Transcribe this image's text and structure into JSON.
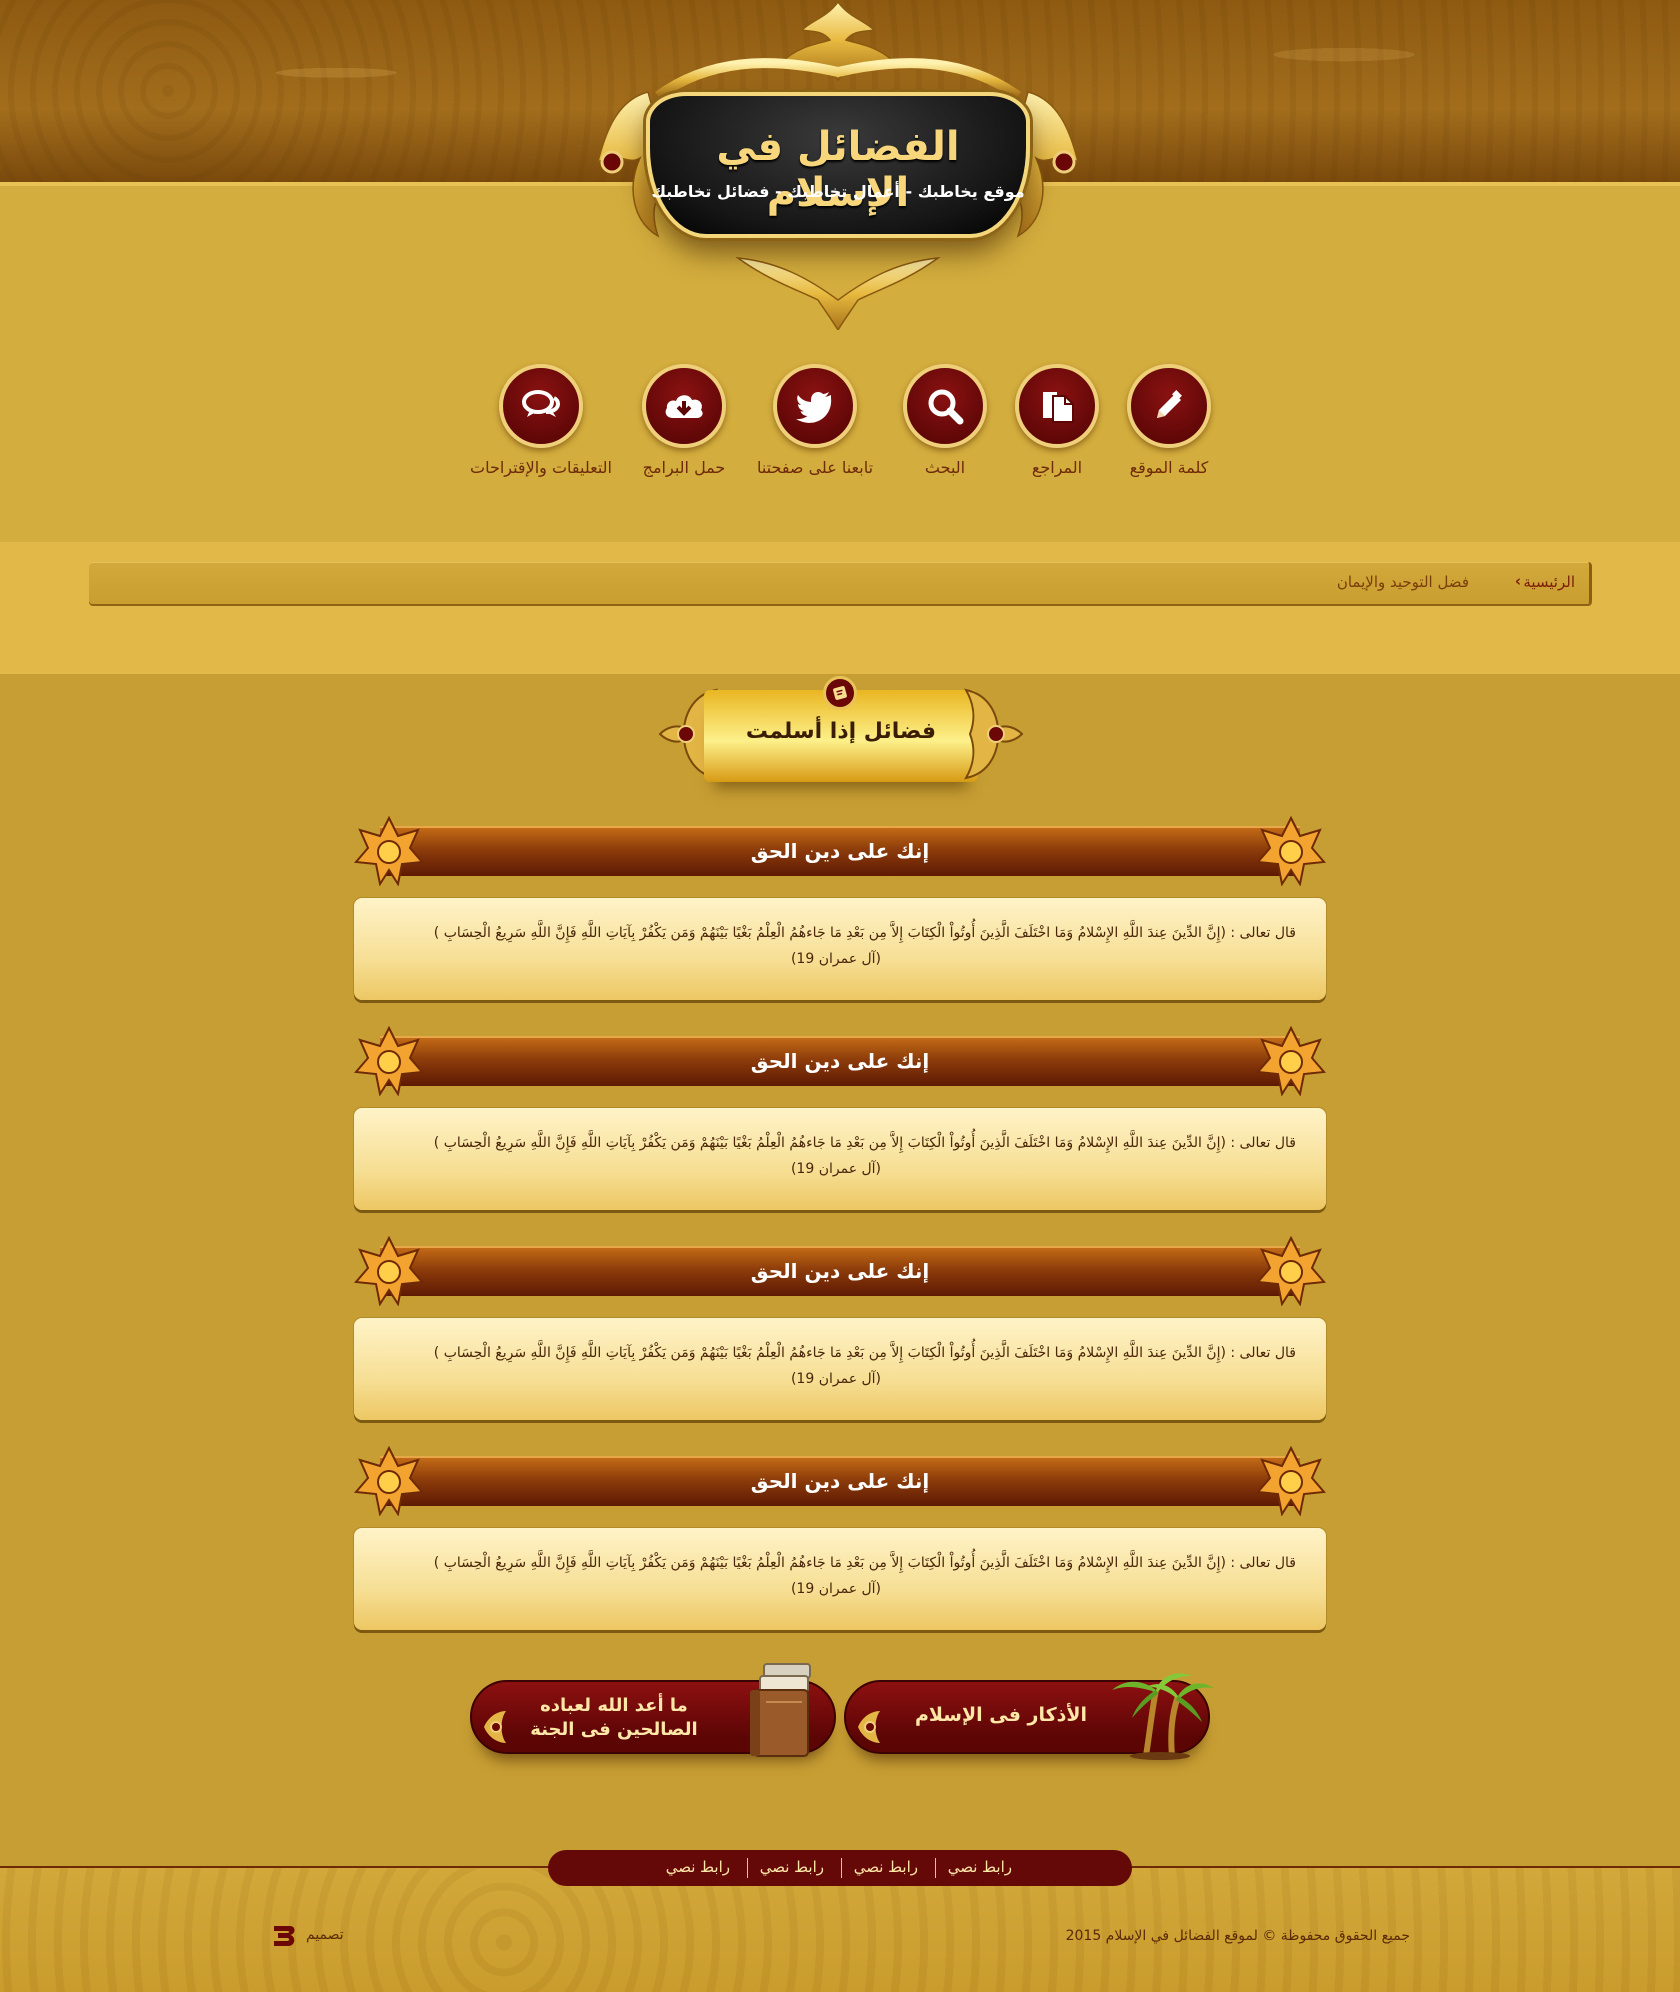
{
  "site": {
    "title": "الفضائل في الإسلام",
    "tagline": "موقع يخاطبك - أعمال تخاطبك - فضائل تخاطبك"
  },
  "nav": [
    {
      "label": "كلمة الموقع",
      "icon": "pencil-icon"
    },
    {
      "label": "المراجع",
      "icon": "documents-icon"
    },
    {
      "label": "البحث",
      "icon": "search-icon"
    },
    {
      "label": "تابعنا على صفحتنا",
      "icon": "twitter-icon"
    },
    {
      "label": "حمل البرامج",
      "icon": "cloud-download-icon"
    },
    {
      "label": "التعليقات والإقتراحات",
      "icon": "comments-icon"
    }
  ],
  "breadcrumb": {
    "home": "الرئيسية",
    "current": "فضل التوحيد والإيمان"
  },
  "section": {
    "title": "فضائل إذا أسلمت",
    "icon": "book-icon"
  },
  "articles": [
    {
      "heading": "إنك على دين الحق",
      "text": "قال تعالى : (إِنَّ الدِّينَ عِندَ اللَّهِ الإِسْلامُ وَمَا اخْتَلَفَ الَّذِينَ أُوتُواْ الْكِتَابَ إِلاَّ مِن بَعْدِ مَا جَاءهُمُ الْعِلْمُ بَغْيًا بَيْنَهُمْ وَمَن يَكْفُرْ بِآيَاتِ اللَّهِ فَإِنَّ اللَّهِ سَرِيعُ الْحِسَابِ )",
      "reference": "(آل عمران 19)"
    },
    {
      "heading": "إنك على دين الحق",
      "text": "قال تعالى : (إِنَّ الدِّينَ عِندَ اللَّهِ الإِسْلامُ وَمَا اخْتَلَفَ الَّذِينَ أُوتُواْ الْكِتَابَ إِلاَّ مِن بَعْدِ مَا جَاءهُمُ الْعِلْمُ بَغْيًا بَيْنَهُمْ وَمَن يَكْفُرْ بِآيَاتِ اللَّهِ فَإِنَّ اللَّهِ سَرِيعُ الْحِسَابِ )",
      "reference": "(آل عمران 19)"
    },
    {
      "heading": "إنك على دين الحق",
      "text": "قال تعالى : (إِنَّ الدِّينَ عِندَ اللَّهِ الإِسْلامُ وَمَا اخْتَلَفَ الَّذِينَ أُوتُواْ الْكِتَابَ إِلاَّ مِن بَعْدِ مَا جَاءهُمُ الْعِلْمُ بَغْيًا بَيْنَهُمْ وَمَن يَكْفُرْ بِآيَاتِ اللَّهِ فَإِنَّ اللَّهِ سَرِيعُ الْحِسَابِ )",
      "reference": "(آل عمران 19)"
    },
    {
      "heading": "إنك على دين الحق",
      "text": "قال تعالى : (إِنَّ الدِّينَ عِندَ اللَّهِ الإِسْلامُ وَمَا اخْتَلَفَ الَّذِينَ أُوتُواْ الْكِتَابَ إِلاَّ مِن بَعْدِ مَا جَاءهُمُ الْعِلْمُ بَغْيًا بَيْنَهُمْ وَمَن يَكْفُرْ بِآيَاتِ اللَّهِ فَإِنَّ اللَّهِ سَرِيعُ الْحِسَابِ )",
      "reference": "(آل عمران 19)"
    }
  ],
  "promos": [
    {
      "label": "الأذكار فى الإسلام",
      "icon": "palm-tree-icon"
    },
    {
      "label": "ما أعد الله لعباده الصالحين فى الجنة",
      "icon": "books-icon"
    }
  ],
  "footer": {
    "links": [
      "رابط نصي",
      "رابط نصي",
      "رابط نصي",
      "رابط نصي"
    ],
    "copyright": "جميع الحقوق محفوظة © لموقع الفضائل في الإسلام 2015",
    "design_label": "تصميم"
  },
  "colors": {
    "page_background": "#c79e33",
    "header_band": "#8e5a12",
    "maroon": "#5d0606",
    "gold_accent": "#f0cf7a",
    "card_background": "#f6df95"
  }
}
